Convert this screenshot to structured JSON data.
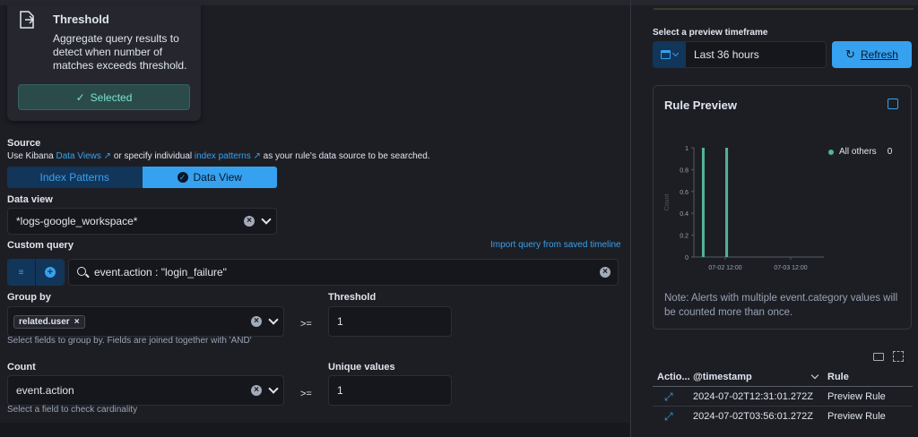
{
  "rule_type_card": {
    "title": "Threshold",
    "description": "Aggregate query results to detect when number of matches exceeds threshold.",
    "selected_label": "Selected"
  },
  "source": {
    "label": "Source",
    "help_prefix": "Use Kibana",
    "data_views_link": "Data Views",
    "help_middle": "or specify individual",
    "index_patterns_link": "index patterns",
    "help_suffix": "as your rule's data source to be searched.",
    "toggle_index_patterns": "Index Patterns",
    "toggle_data_view": "Data View"
  },
  "data_view": {
    "label": "Data view",
    "value": "*logs-google_workspace*"
  },
  "custom_query": {
    "label": "Custom query",
    "import_link": "Import query from saved timeline",
    "value": "event.action : \"login_failure\""
  },
  "group_by": {
    "label": "Group by",
    "pill": "related.user",
    "help": "Select fields to group by. Fields are joined together with 'AND'",
    "operator": ">=",
    "threshold_label": "Threshold",
    "threshold_value": "1"
  },
  "count": {
    "label": "Count",
    "value": "event.action",
    "help": "Select a field to check cardinality",
    "operator": ">=",
    "unique_label": "Unique values",
    "unique_value": "1"
  },
  "preview": {
    "timeframe_label": "Select a preview timeframe",
    "timeframe_value": "Last 36 hours",
    "refresh_label": "Refresh",
    "title": "Rule Preview",
    "legend_name": "All others",
    "legend_value": "0",
    "note": "Note: Alerts with multiple event.category values will be counted more than once."
  },
  "chart_data": {
    "type": "bar",
    "ylabel": "Count",
    "ylim": [
      0,
      1
    ],
    "y_ticks": [
      "0",
      "0.2",
      "0.4",
      "0.6",
      "0.8",
      "1"
    ],
    "x_ticks": [
      "07-02 12:00",
      "07-03 12:00"
    ],
    "series": [
      {
        "name": "All others",
        "color": "#54b399",
        "values": [
          1,
          1
        ]
      }
    ],
    "bar_times": [
      "2024-07-02T03:56:01.272Z",
      "2024-07-02T12:31:01.272Z"
    ]
  },
  "table": {
    "columns": [
      "Actio...",
      "@timestamp",
      "Rule"
    ],
    "rows": [
      {
        "timestamp": "2024-07-02T12:31:01.272Z",
        "rule": "Preview Rule"
      },
      {
        "timestamp": "2024-07-02T03:56:01.272Z",
        "rule": "Preview Rule"
      }
    ]
  }
}
